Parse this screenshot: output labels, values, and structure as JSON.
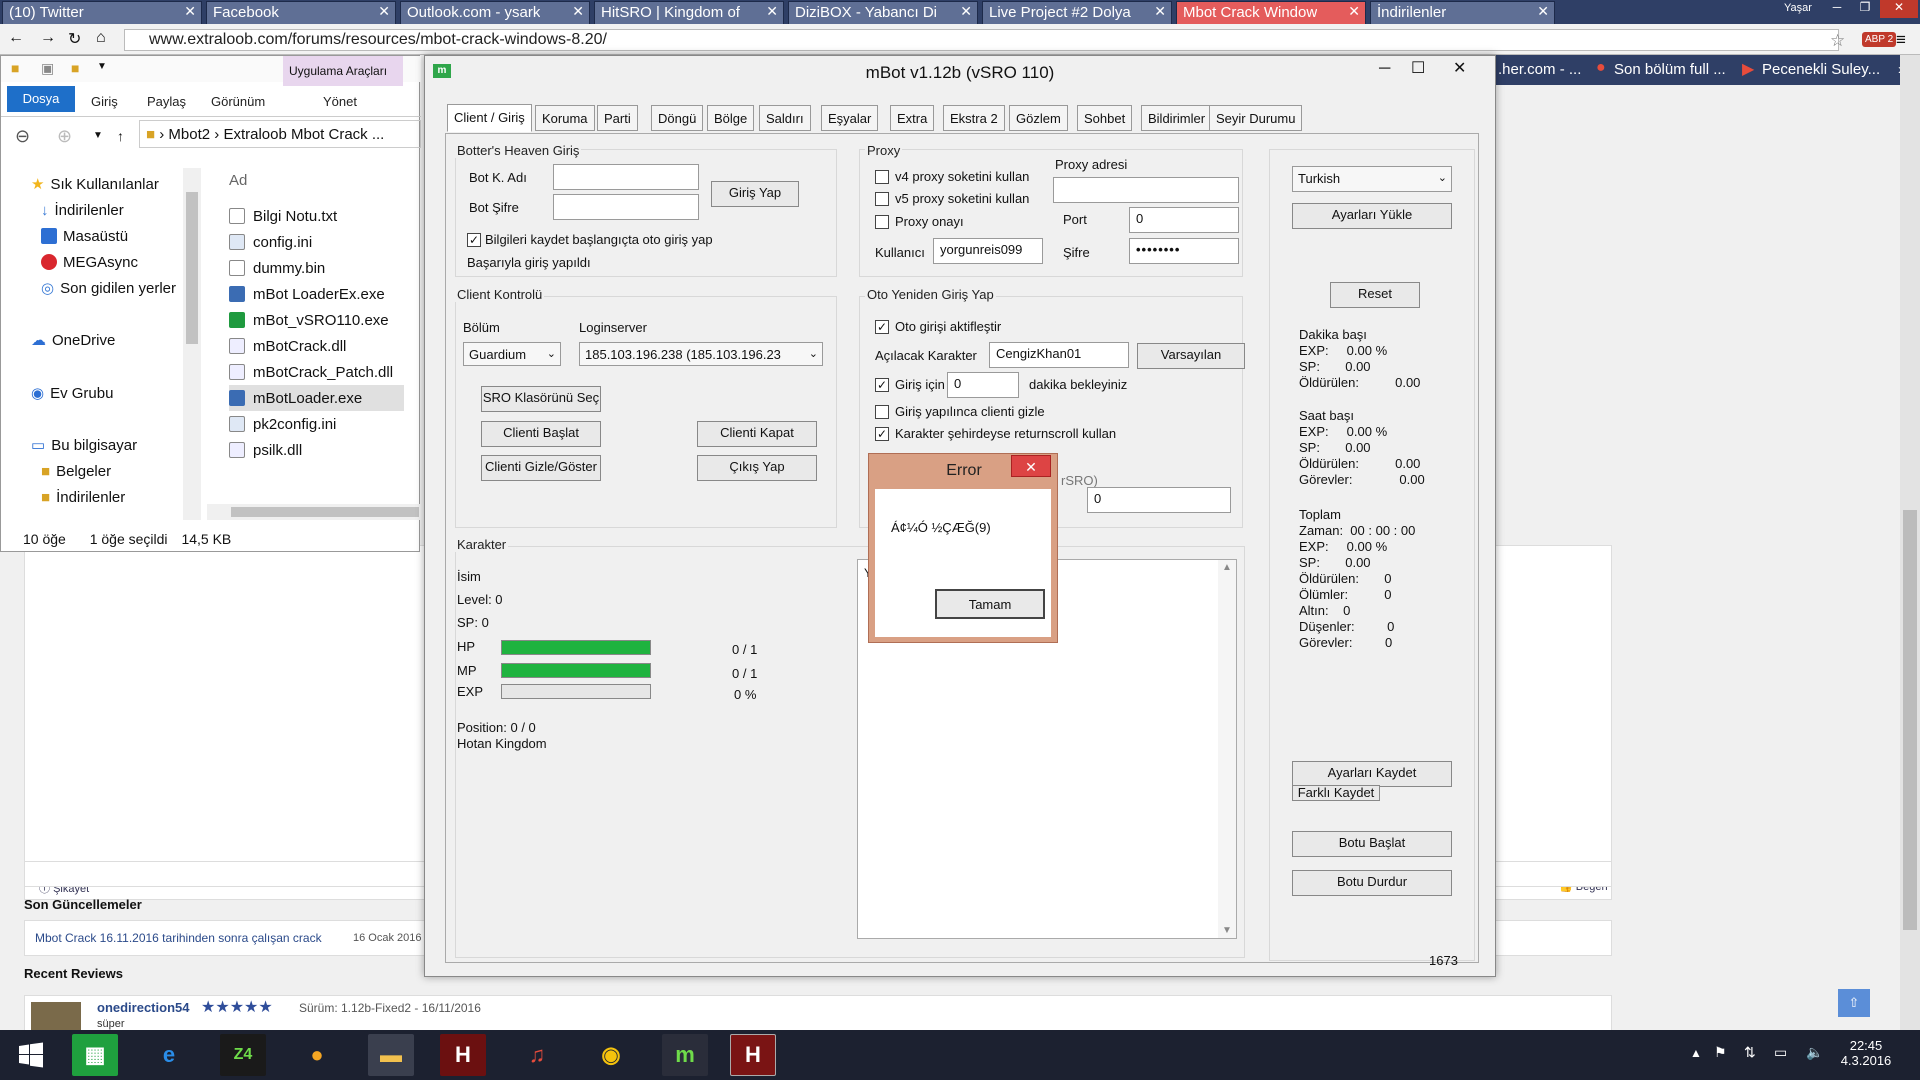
{
  "browser": {
    "tabs": [
      {
        "label": "(10) Twitter"
      },
      {
        "label": "Facebook"
      },
      {
        "label": "Outlook.com - ysark"
      },
      {
        "label": "HitSRO | Kingdom of"
      },
      {
        "label": "DiziBOX - Yabancı Di"
      },
      {
        "label": "Live Project #2 Dolya"
      },
      {
        "label": "Mbot Crack Window"
      },
      {
        "label": "İndirilenler"
      }
    ],
    "user": "Yaşar",
    "url": "www.extraloob.com/forums/resources/mbot-crack-windows-8.20/",
    "bookmarks": [
      ".her.com - ...",
      "Son bölüm full ...",
      "Pecenekli Suley..."
    ],
    "abp_count": "ABP 2"
  },
  "explorer": {
    "ribbon_tools": "Uygulama Araçları",
    "tabs": [
      "Dosya",
      "Giriş",
      "Paylaş",
      "Görünüm",
      "Yönet"
    ],
    "breadcrumb": [
      "Mbot2",
      "Extraloob Mbot Crack ..."
    ],
    "column": "Ad",
    "sidebar": [
      "Sık Kullanılanlar",
      "İndirilenler",
      "Masaüstü",
      "MEGAsync",
      "Son gidilen yerler",
      "OneDrive",
      "Ev Grubu",
      "Bu bilgisayar",
      "Belgeler",
      "İndirilenler"
    ],
    "files": [
      "Bilgi Notu.txt",
      "config.ini",
      "dummy.bin",
      "mBot LoaderEx.exe",
      "mBot_vSRO110.exe",
      "mBotCrack.dll",
      "mBotCrack_Patch.dll",
      "mBotLoader.exe",
      "pk2config.ini",
      "psilk.dll"
    ],
    "status": {
      "count": "10 öğe",
      "selected": "1 öğe seçildi",
      "size": "14,5 KB"
    }
  },
  "webpage": {
    "report": "Şikayet",
    "like": "Beğen",
    "updates_title": "Son Güncellemeler",
    "update_link": "Mbot Crack 16.11.2016 tarihinden sonra çalışan crack",
    "update_date": "16 Ocak 2016",
    "reviews_title": "Recent Reviews",
    "reviewer": "onedirection54",
    "stars": "★★★★★",
    "rating": 5,
    "review_version": "Sürüm: 1.12b-Fixed2 - 16/11/2016",
    "review_text": "süper"
  },
  "mbot": {
    "title": "mBot v1.12b (vSRO 110)",
    "tabs": [
      "Client / Giriş",
      "Koruma",
      "Parti",
      "Döngü",
      "Bölge",
      "Saldırı",
      "Eşyalar",
      "Extra",
      "Ekstra 2",
      "Gözlem",
      "Sohbet",
      "Bildirimler",
      "Seyir Durumu"
    ],
    "login": {
      "group": "Botter's Heaven Giriş",
      "user_label": "Bot K. Adı",
      "user_value": "",
      "pass_label": "Bot Şifre",
      "pass_value": "",
      "login_btn": "Giriş Yap",
      "remember": "Bilgileri kaydet başlangıçta oto giriş yap",
      "status": "Başarıyla giriş yapıldı"
    },
    "proxy": {
      "group": "Proxy",
      "v4": "v4 proxy soketini kullan",
      "v5": "v5 proxy soketini kullan",
      "confirm": "Proxy onayı",
      "address_label": "Proxy adresi",
      "address_value": "",
      "port_label": "Port",
      "port_value": "0",
      "user_label": "Kullanıcı",
      "user_value": "yorgunreis099",
      "pass_label": "Şifre",
      "pass_value": "••••••••"
    },
    "client": {
      "group": "Client Kontrolü",
      "section_label": "Bölüm",
      "section_value": "Guardium",
      "server_label": "Loginserver",
      "server_value": "185.103.196.238 (185.103.196.23",
      "folder_btn": "SRO Klasörünü Seç",
      "start_btn": "Clienti Başlat",
      "close_btn": "Clienti Kapat",
      "toggle_btn": "Clienti Gizle/Göster",
      "exit_btn": "Çıkış Yap"
    },
    "relogin": {
      "group": "Oto Yeniden Giriş Yap",
      "enable": "Oto girişi aktifleştir",
      "char_label": "Açılacak Karakter",
      "char_value": "CengizKhan01",
      "default_btn": "Varsayılan",
      "wait_label": "Giriş için",
      "wait_value": "0",
      "wait_suffix": "dakika bekleyiniz",
      "hide": "Giriş yapılınca clienti gizle",
      "return": "Karakter şehirdeyse returnscroll kullan",
      "hidden_suffix": "rSRO)",
      "hidden_value": "0"
    },
    "character": {
      "group": "Karakter",
      "name_label": "İsim",
      "level": "Level: 0",
      "sp": "SP: 0",
      "hp_label": "HP",
      "hp_value": "0 / 1",
      "hp_fill": 100,
      "mp_label": "MP",
      "mp_value": "0 / 1",
      "mp_fill": 100,
      "exp_label": "EXP",
      "exp_value": "0 %",
      "exp_fill": 0,
      "position": "Position: 0 / 0",
      "location": "Hotan Kingdom"
    },
    "log_marker": "Y",
    "right": {
      "language": "Turkish",
      "load_btn": "Ayarları Yükle",
      "reset_btn": "Reset",
      "per_min_title": "Dakika başı",
      "per_min": "EXP:     0.00 %\nSP:       0.00\nÖldürülen:          0.00",
      "per_hour_title": "Saat başı",
      "per_hour": "EXP:     0.00 %\nSP:       0.00\nÖldürülen:          0.00\nGörevler:             0.00",
      "total_title": "Toplam",
      "total": "Zaman:  00 : 00 : 00\nEXP:     0.00 %\nSP:       0.00\nÖldürülen:       0\nÖlümler:          0\nAltın:    0\nDüşenler:         0\nGörevler:         0",
      "save_btn": "Ayarları Kaydet",
      "save_as_btn": "Farklı Kaydet",
      "start_btn": "Botu Başlat",
      "stop_btn": "Botu Durdur",
      "counter": "1673"
    }
  },
  "error_dialog": {
    "title": "Error",
    "message": "Á¢¼Ó ½ÇÆĞ(9)",
    "ok": "Tamam"
  },
  "taskbar": {
    "time": "22:45",
    "date": "4.3.2016"
  }
}
